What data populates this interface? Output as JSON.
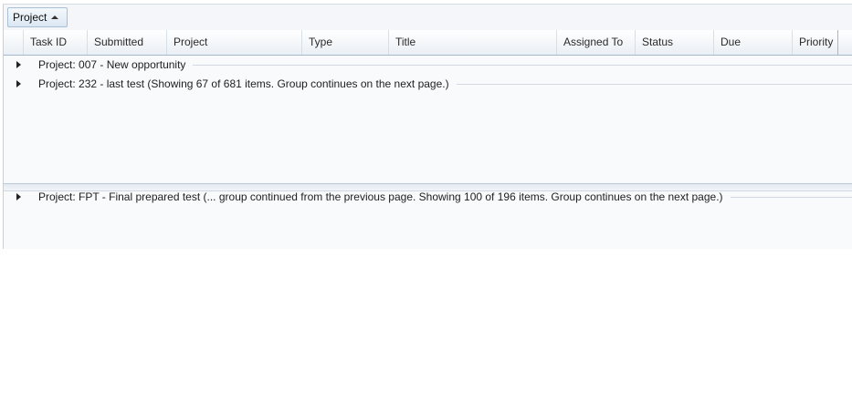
{
  "grouping": {
    "chip_label": "Project",
    "sort_icon": "sort-ascending-icon"
  },
  "columns": [
    {
      "key": "task_id",
      "label": "Task ID"
    },
    {
      "key": "submitted",
      "label": "Submitted"
    },
    {
      "key": "project",
      "label": "Project"
    },
    {
      "key": "type",
      "label": "Type"
    },
    {
      "key": "title",
      "label": "Title"
    },
    {
      "key": "assigned_to",
      "label": "Assigned To"
    },
    {
      "key": "status",
      "label": "Status"
    },
    {
      "key": "due",
      "label": "Due"
    },
    {
      "key": "priority",
      "label": "Priority"
    }
  ],
  "groups": [
    {
      "label": "Project: 007 - New opportunity",
      "expander_icon": "expand-arrow-icon"
    },
    {
      "label": "Project: 232 - last test (Showing 67 of 681 items. Group continues on the next page.)",
      "expander_icon": "expand-arrow-icon"
    },
    {
      "label": "Project: FPT - Final prepared test (... group continued from the previous page. Showing 100 of 196 items. Group continues on the next page.)",
      "expander_icon": "expand-arrow-icon"
    }
  ],
  "colors": {
    "header_border": "#a6b8cd",
    "chip_border": "#a9bfd6",
    "background": "#f9fafb"
  }
}
